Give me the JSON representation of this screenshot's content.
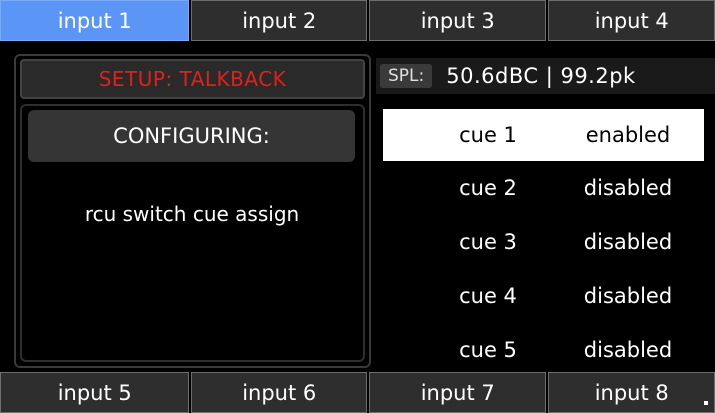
{
  "top_tabs": [
    {
      "label": "input 1",
      "active": true
    },
    {
      "label": "input 2",
      "active": false
    },
    {
      "label": "input 3",
      "active": false
    },
    {
      "label": "input 4",
      "active": false
    }
  ],
  "bottom_tabs": [
    {
      "label": "input 5"
    },
    {
      "label": "input 6"
    },
    {
      "label": "input 7"
    },
    {
      "label": "input 8"
    }
  ],
  "setup": {
    "title": "SETUP: TALKBACK",
    "title_color": "#e0201c",
    "configuring_label": "CONFIGURING:",
    "description": "rcu switch cue assign"
  },
  "spl": {
    "label": "SPL:",
    "value": "50.6dBC | 99.2pk"
  },
  "cues": [
    {
      "name": "cue 1",
      "state": "enabled",
      "selected": true
    },
    {
      "name": "cue 2",
      "state": "disabled",
      "selected": false
    },
    {
      "name": "cue 3",
      "state": "disabled",
      "selected": false
    },
    {
      "name": "cue 4",
      "state": "disabled",
      "selected": false
    },
    {
      "name": "cue 5",
      "state": "disabled",
      "selected": false
    }
  ],
  "colors": {
    "active_tab": "#5b95f6",
    "tab_bg": "#2e2e2e",
    "accent_red": "#e0201c"
  }
}
